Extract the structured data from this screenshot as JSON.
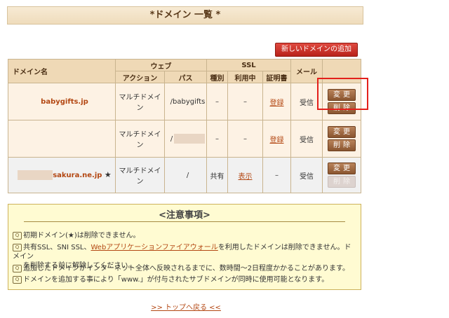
{
  "page_title": "*ドメイン 一覧 *",
  "new_domain_button": "新しいドメインの追加",
  "headers": {
    "domain_name": "ドメイン名",
    "web": "ウェブ",
    "action": "アクション",
    "path": "パス",
    "ssl": "SSL",
    "type": "種別",
    "in_use": "利用中",
    "cert": "証明書",
    "mail": "メール"
  },
  "rows": [
    {
      "domain": "babygifts.jp",
      "action": "マルチドメイン",
      "path": "/babygifts",
      "type": "–",
      "in_use": "–",
      "cert": "登録",
      "mail": "受信",
      "change": "変更",
      "delete": "削除"
    },
    {
      "domain": "",
      "action": "マルチドメイン",
      "path": "/",
      "type": "–",
      "in_use": "–",
      "cert": "登録",
      "mail": "受信",
      "change": "変更",
      "delete": "削除"
    },
    {
      "domain": "sakura.ne.jp",
      "star": "★",
      "action": "マルチドメイン",
      "path": "/",
      "type": "共有",
      "in_use": "表示",
      "cert": "–",
      "mail": "受信",
      "change": "変更",
      "delete": "削除"
    }
  ],
  "notes": {
    "title": "<注意事項>",
    "n1": "初期ドメイン(★)は削除できません。",
    "n2_pre": "共有SSL、SNI SSL、",
    "n2_link": "Webアプリケーションファイアウォール",
    "n2_post": "を利用したドメインは削除できません。ドメイン",
    "n2_cont": "を削除する前に解除してください。",
    "n3": "追加したドメインがインターネット全体へ反映されるまでに、数時間～2日程度かかることがあります。",
    "n4": "ドメインを追加する事により「www.」が付与されたサブドメインが同時に使用可能となります。"
  },
  "footer_link": ">> トップへ戻る <<"
}
